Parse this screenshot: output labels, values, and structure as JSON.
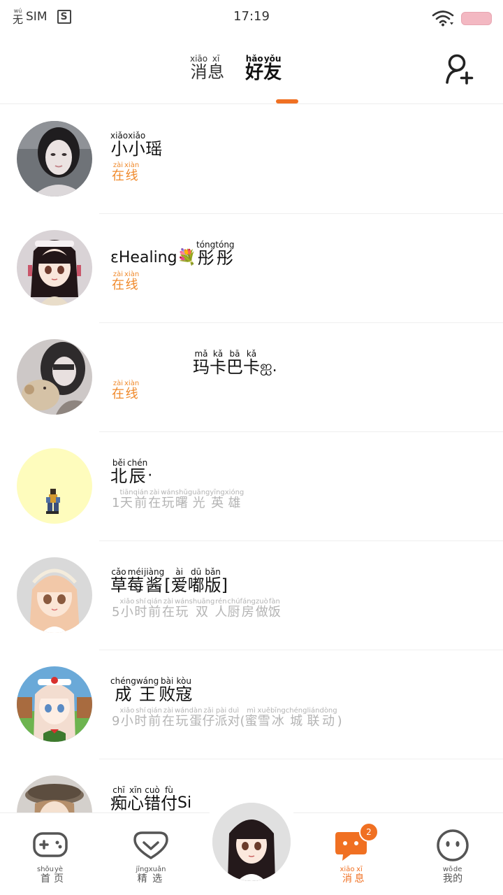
{
  "status_bar": {
    "sim_pinyin": "wú",
    "sim_char": "无",
    "sim_text": "SIM",
    "sim_app_icon_text": "S",
    "time": "17:19",
    "wifi_icon": "wifi-icon",
    "battery_color": "#f3b8c2"
  },
  "header": {
    "tabs": [
      {
        "label": [
          {
            "py": "xiāo",
            "hz": "消"
          },
          {
            "py": "xī",
            "hz": "息"
          }
        ],
        "active": false
      },
      {
        "label": [
          {
            "py": "hǎo",
            "hz": "好"
          },
          {
            "py": "yǒu",
            "hz": "友"
          }
        ],
        "active": true
      }
    ],
    "add_friend_icon": "add-person-icon",
    "accent_color": "#f07022"
  },
  "friends": [
    {
      "name": [
        {
          "py": "xiǎo",
          "hz": "小"
        },
        {
          "py": "xiǎo",
          "hz": "小"
        },
        {
          "py": "",
          "hz": "瑶"
        }
      ],
      "status": [
        {
          "py": "zài",
          "hz": "在"
        },
        {
          "py": "xiàn",
          "hz": "线"
        }
      ],
      "online": true
    },
    {
      "name_prefix": "εHealing💐",
      "name": [
        {
          "py": "tóng",
          "hz": "彤"
        },
        {
          "py": "tóng",
          "hz": "彤"
        }
      ],
      "status": [
        {
          "py": "zài",
          "hz": "在"
        },
        {
          "py": "xiàn",
          "hz": "线"
        }
      ],
      "online": true
    },
    {
      "name": [
        {
          "py": "mǎ",
          "hz": "玛"
        },
        {
          "py": "kǎ",
          "hz": "卡"
        },
        {
          "py": "bā",
          "hz": "巴"
        },
        {
          "py": "kǎ",
          "hz": "卡"
        }
      ],
      "name_suffix": "ஐ.",
      "status": [
        {
          "py": "zài",
          "hz": "在"
        },
        {
          "py": "xiàn",
          "hz": "线"
        }
      ],
      "online": true
    },
    {
      "name": [
        {
          "py": "běi",
          "hz": "北"
        },
        {
          "py": "chén",
          "hz": "辰"
        }
      ],
      "name_suffix": "·",
      "status_prefix": "1",
      "status": [
        {
          "py": "tiān",
          "hz": "天"
        },
        {
          "py": "qián",
          "hz": "前"
        },
        {
          "py": "zài",
          "hz": "在"
        },
        {
          "py": "wán",
          "hz": "玩"
        },
        {
          "py": "shǔ",
          "hz": "曙"
        },
        {
          "py": "guāng",
          "hz": "光"
        },
        {
          "py": "yīng",
          "hz": "英"
        },
        {
          "py": "xióng",
          "hz": "雄"
        }
      ],
      "online": false
    },
    {
      "name": [
        {
          "py": "cǎo",
          "hz": "草"
        },
        {
          "py": "méi",
          "hz": "莓"
        },
        {
          "py": "jiàng",
          "hz": "酱"
        },
        {
          "py": "",
          "hz": "["
        },
        {
          "py": "ài",
          "hz": "爱"
        },
        {
          "py": "dū",
          "hz": "嘟"
        },
        {
          "py": "bǎn",
          "hz": "版"
        },
        {
          "py": "",
          "hz": "]"
        }
      ],
      "status_prefix": "5",
      "status": [
        {
          "py": "xiǎo",
          "hz": "小"
        },
        {
          "py": "shí",
          "hz": "时"
        },
        {
          "py": "qián",
          "hz": "前"
        },
        {
          "py": "zài",
          "hz": "在"
        },
        {
          "py": "wán",
          "hz": "玩"
        },
        {
          "py": "shuāng",
          "hz": "双"
        },
        {
          "py": "rén",
          "hz": "人"
        },
        {
          "py": "chú",
          "hz": "厨"
        },
        {
          "py": "fáng",
          "hz": "房"
        },
        {
          "py": "zuò",
          "hz": "做"
        },
        {
          "py": "fàn",
          "hz": "饭"
        }
      ],
      "online": false
    },
    {
      "name": [
        {
          "py": "chéng",
          "hz": "成"
        },
        {
          "py": "wáng",
          "hz": "王"
        },
        {
          "py": "bài",
          "hz": "败"
        },
        {
          "py": "kòu",
          "hz": "寇"
        }
      ],
      "status_prefix": "9",
      "status": [
        {
          "py": "xiǎo",
          "hz": "小"
        },
        {
          "py": "shí",
          "hz": "时"
        },
        {
          "py": "qián",
          "hz": "前"
        },
        {
          "py": "zài",
          "hz": "在"
        },
        {
          "py": "wán",
          "hz": "玩"
        },
        {
          "py": "dàn",
          "hz": "蛋"
        },
        {
          "py": "zǎi",
          "hz": "仔"
        },
        {
          "py": "pài",
          "hz": "派"
        },
        {
          "py": "duì",
          "hz": "对"
        },
        {
          "py": "",
          "hz": "("
        },
        {
          "py": "mì",
          "hz": "蜜"
        },
        {
          "py": "xuě",
          "hz": "雪"
        },
        {
          "py": "bīng",
          "hz": "冰"
        },
        {
          "py": "chéng",
          "hz": "城"
        },
        {
          "py": "lián",
          "hz": "联"
        },
        {
          "py": "dòng",
          "hz": "动"
        },
        {
          "py": "",
          "hz": ")"
        }
      ],
      "online": false
    },
    {
      "name": [
        {
          "py": "chī",
          "hz": "痴"
        },
        {
          "py": "xīn",
          "hz": "心"
        },
        {
          "py": "cuò",
          "hz": "错"
        },
        {
          "py": "fù",
          "hz": "付"
        }
      ],
      "name_suffix": "Si",
      "status": [],
      "online": false
    }
  ],
  "bottom_nav": {
    "items": [
      {
        "icon": "gamepad-icon",
        "label": [
          {
            "py": "shǒu",
            "hz": "首"
          },
          {
            "py": "yè",
            "hz": "页"
          }
        ],
        "active": false
      },
      {
        "icon": "heart-icon",
        "label": [
          {
            "py": "jīng",
            "hz": "精"
          },
          {
            "py": "xuǎn",
            "hz": "选"
          }
        ],
        "active": false
      },
      {
        "icon": "chat-bubble-icon",
        "label": [
          {
            "py": "xiāo",
            "hz": "消"
          },
          {
            "py": "xī",
            "hz": "息"
          }
        ],
        "active": true,
        "badge": "2"
      },
      {
        "icon": "smiley-face-icon",
        "label": [
          {
            "py": "wǒ",
            "hz": "我"
          },
          {
            "py": "de",
            "hz": "的"
          }
        ],
        "active": false
      }
    ],
    "center_icon": "user-avatar-icon"
  }
}
